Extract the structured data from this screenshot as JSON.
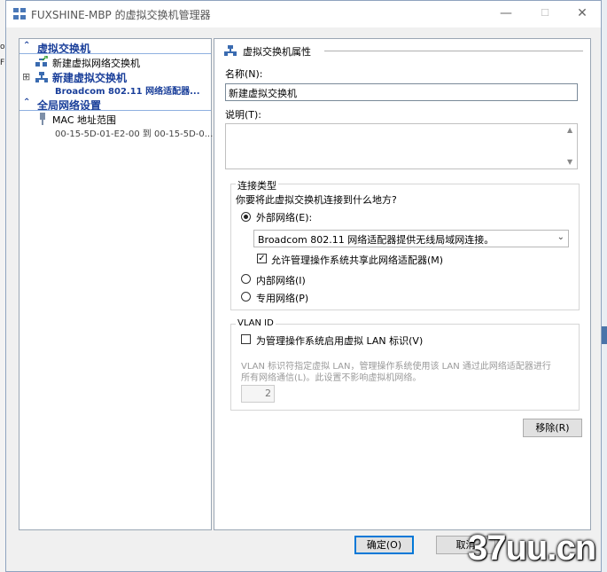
{
  "background": {
    "left_fragments": [
      "oe",
      "Fl"
    ]
  },
  "window": {
    "title": "FUXSHINE-MBP 的虚拟交换机管理器",
    "controls": [
      "—",
      "☐",
      "✕"
    ]
  },
  "left_pane": {
    "sections": [
      {
        "label": "虚拟交换机"
      },
      {
        "label": "全局网络设置"
      }
    ],
    "items": {
      "new_switch": "新建虚拟网络交换机",
      "switch_name": "新建虚拟交换机",
      "switch_adapter": "Broadcom 802.11 网络适配器...",
      "mac_label": "MAC 地址范围",
      "mac_value": "00-15-5D-01-E2-00 到 00-15-5D-0..."
    },
    "expander": "⊞"
  },
  "right_pane": {
    "header": "虚拟交换机属性",
    "name_label": "名称(N):",
    "name_value": "新建虚拟交换机",
    "notes_label": "说明(T):",
    "notes_value": "",
    "connection": {
      "title": "连接类型",
      "question": "你要将此虚拟交换机连接到什么地方?",
      "external_label": "外部网络(E):",
      "adapter_selected": "Broadcom 802.11 网络适配器提供无线局域网连接。",
      "allow_share_label": "允许管理操作系统共享此网络适配器(M)",
      "internal_label": "内部网络(I)",
      "private_label": "专用网络(P)",
      "selected": "external",
      "allow_share_checked": true
    },
    "vlan": {
      "title": "VLAN ID",
      "enable_label": "为管理操作系统启用虚拟 LAN 标识(V)",
      "enable_checked": false,
      "description_line1": "VLAN 标识符指定虚拟 LAN，管理操作系统使用该 LAN 通过此网络适配器进行",
      "description_line2": "所有网络通信(L)。此设置不影响虚拟机网络。",
      "value": "2"
    },
    "remove_button": "移除(R)"
  },
  "footer": {
    "ok": "确定(O)",
    "cancel": "取消"
  },
  "watermark": "37uu.cn",
  "colors": {
    "section_blue": "#1a3f9a",
    "accent": "#0078d7"
  }
}
